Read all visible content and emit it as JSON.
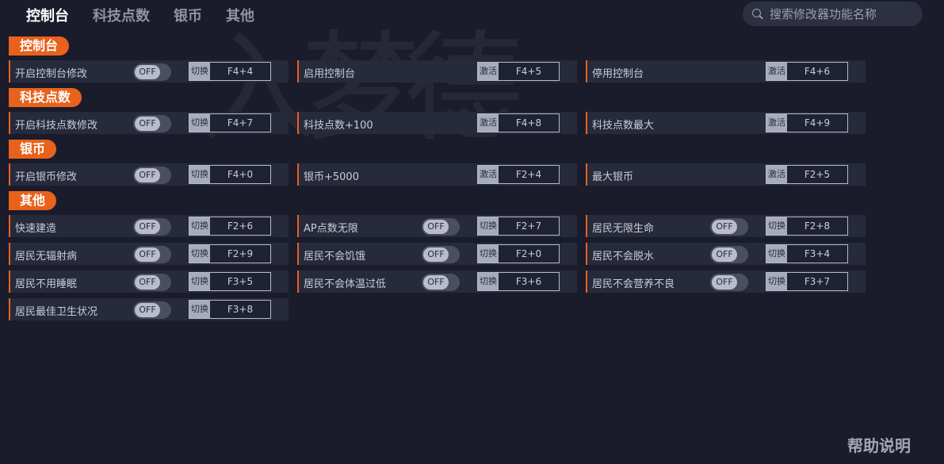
{
  "tabs": [
    {
      "label": "控制台",
      "active": true
    },
    {
      "label": "科技点数",
      "active": false
    },
    {
      "label": "银币",
      "active": false
    },
    {
      "label": "其他",
      "active": false
    }
  ],
  "search": {
    "placeholder": "搜索修改器功能名称",
    "icon": "search-icon"
  },
  "background_art": "入梦德",
  "sections": [
    {
      "title": "控制台",
      "items": [
        {
          "label": "开启控制台修改",
          "toggle": "OFF",
          "action": "切换",
          "key": "F4+4"
        },
        {
          "label": "启用控制台",
          "action": "激活",
          "key": "F4+5"
        },
        {
          "label": "停用控制台",
          "action": "激活",
          "key": "F4+6"
        }
      ]
    },
    {
      "title": "科技点数",
      "items": [
        {
          "label": "开启科技点数修改",
          "toggle": "OFF",
          "action": "切换",
          "key": "F4+7"
        },
        {
          "label": "科技点数+100",
          "action": "激活",
          "key": "F4+8"
        },
        {
          "label": "科技点数最大",
          "action": "激活",
          "key": "F4+9"
        }
      ]
    },
    {
      "title": "银币",
      "items": [
        {
          "label": "开启银币修改",
          "toggle": "OFF",
          "action": "切换",
          "key": "F4+0"
        },
        {
          "label": "银币+5000",
          "action": "激活",
          "key": "F2+4"
        },
        {
          "label": "最大银币",
          "action": "激活",
          "key": "F2+5"
        }
      ]
    },
    {
      "title": "其他",
      "items": [
        {
          "label": "快速建造",
          "toggle": "OFF",
          "action": "切换",
          "key": "F2+6"
        },
        {
          "label": "AP点数无限",
          "toggle": "OFF",
          "action": "切换",
          "key": "F2+7"
        },
        {
          "label": "居民无限生命",
          "toggle": "OFF",
          "action": "切换",
          "key": "F2+8"
        },
        {
          "label": "居民无辐射病",
          "toggle": "OFF",
          "action": "切换",
          "key": "F2+9"
        },
        {
          "label": "居民不会饥饿",
          "toggle": "OFF",
          "action": "切换",
          "key": "F2+0"
        },
        {
          "label": "居民不会脱水",
          "toggle": "OFF",
          "action": "切换",
          "key": "F3+4"
        },
        {
          "label": "居民不用睡眠",
          "toggle": "OFF",
          "action": "切换",
          "key": "F3+5"
        },
        {
          "label": "居民不会体温过低",
          "toggle": "OFF",
          "action": "切换",
          "key": "F3+6"
        },
        {
          "label": "居民不会营养不良",
          "toggle": "OFF",
          "action": "切换",
          "key": "F3+7"
        },
        {
          "label": "居民最佳卫生状况",
          "toggle": "OFF",
          "action": "切换",
          "key": "F3+8"
        }
      ]
    }
  ],
  "help_label": "帮助说明",
  "colors": {
    "accent": "#e8621c",
    "background": "#1a1c2b",
    "cell": "#262a3b"
  }
}
